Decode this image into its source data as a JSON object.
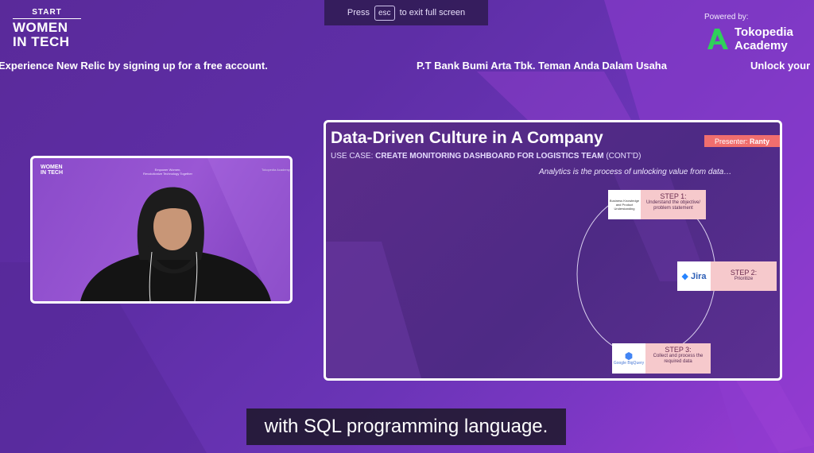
{
  "fullscreen_hint": {
    "prefix": "Press",
    "key": "esc",
    "suffix": "to exit full screen"
  },
  "event_logo": {
    "small": "START",
    "line1": "WOMEN",
    "line2": "IN TECH"
  },
  "sponsor": {
    "powered_by": "Powered by:",
    "name_line1": "Tokopedia",
    "name_line2": "Academy"
  },
  "ticker": {
    "items": [
      "Experience New Relic by signing up for a free account.",
      "P.T Bank Bumi Arta Tbk. Teman Anda Dalam Usaha",
      "Unlock your"
    ]
  },
  "camera": {
    "mini_logo_line1": "WOMEN",
    "mini_logo_line2": "IN TECH",
    "mini_tagline_1": "Empower Women,",
    "mini_tagline_2": "Revolutionize Technology Together",
    "mini_sponsor": "Tokopedia Academy"
  },
  "slide": {
    "title": "Data-Driven Culture in A Company",
    "usecase_prefix": "USE CASE:",
    "usecase_bold": "CREATE MONITORING DASHBOARD FOR LOGISTICS TEAM",
    "usecase_suffix": "(CONT'D)",
    "presenter_label": "Presenter:",
    "presenter_name": "Ranty",
    "quote": "Analytics is the process of unlocking value from data…",
    "steps": [
      {
        "title": "STEP 1:",
        "desc": "Understand the objective/ problem statement",
        "icon_text": "Business Knowledge and Product Understanding"
      },
      {
        "title": "STEP 2:",
        "desc": "Prioritize",
        "icon_text": "Jira"
      },
      {
        "title": "STEP 3:",
        "desc": "Collect and process the required data",
        "icon_text": "Google BigQuery"
      }
    ]
  },
  "caption": "with SQL programming language.",
  "colors": {
    "accent_green": "#2fd15a",
    "presenter_red": "#f06e6e",
    "step_pink": "#f6c9cc"
  }
}
